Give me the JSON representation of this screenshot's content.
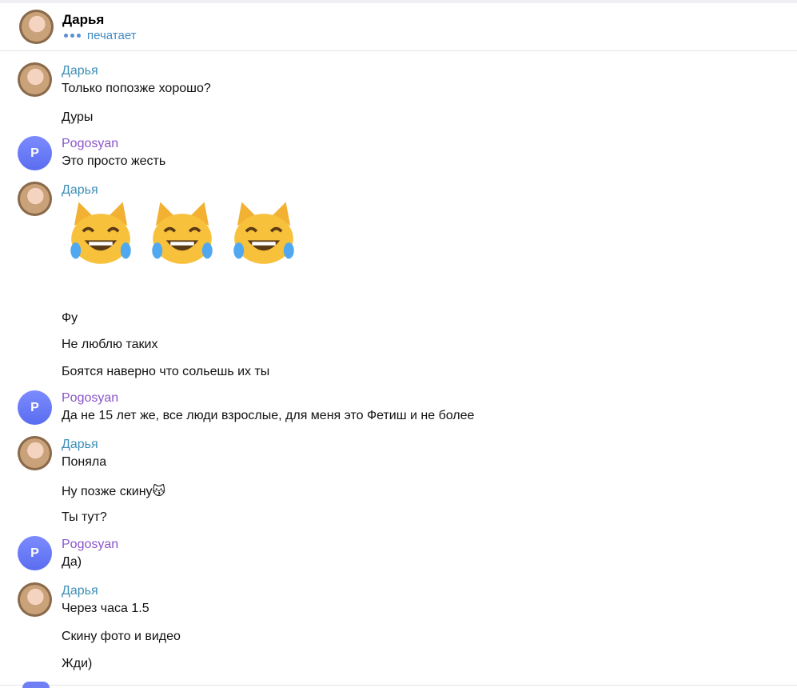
{
  "header": {
    "name": "Дарья",
    "status": "печатает"
  },
  "authors": {
    "daria": "Дарья",
    "pogosyan": "Pogosyan",
    "pogosyan_initial": "P"
  },
  "messages": {
    "m1": "Только попозже хорошо?",
    "m2": "Дуры",
    "m3": "Это просто жесть",
    "m4": "Фу",
    "m5": "Не люблю таких",
    "m6": "Боятся наверно что сольешь их ты",
    "m7": "Да не 15 лет же, все люди взрослые, для меня это Фетиш и не более",
    "m8": "Поняла",
    "m9": "Ну позже скину😽",
    "m10": "Ты тут?",
    "m11": "Да)",
    "m12": "Через часа 1.5",
    "m13": "Скину фото и видео",
    "m14": "Жди)"
  },
  "emoji": {
    "count": 3,
    "name": "cat-tears-of-joy"
  },
  "colors": {
    "daria_name": "#3d8fb8",
    "pogosyan_name": "#8a55c8",
    "status": "#3f8ac4"
  }
}
